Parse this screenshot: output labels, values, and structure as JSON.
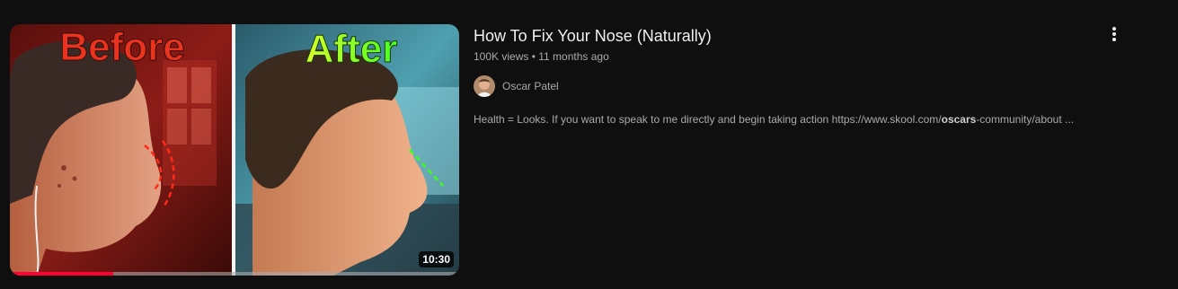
{
  "video": {
    "title": "How To Fix Your Nose (Naturally)",
    "views": "100K views",
    "separator": "•",
    "age": "11 months ago",
    "duration": "10:30",
    "watched_fraction": 0.23,
    "thumbnail": {
      "before_text": "Before",
      "after_text": "After"
    }
  },
  "channel": {
    "name": "Oscar Patel",
    "avatar_icon": "channel-avatar"
  },
  "description": {
    "text_before": "Health = Looks. If you want to speak to me directly and begin taking action https://www.skool.com/",
    "text_bold": "oscars",
    "text_after": "-community/about ..."
  },
  "menu": {
    "icon": "more-vertical-icon"
  },
  "colors": {
    "background": "#0f0f0f",
    "title": "#f1f1f1",
    "secondary_text": "#aaaaaa",
    "progress": "#ff0033",
    "before_red": "#e8341f",
    "after_green": "#7cff1f"
  }
}
